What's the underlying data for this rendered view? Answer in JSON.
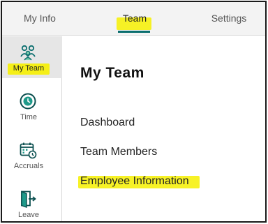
{
  "top_tabs": {
    "my_info": "My Info",
    "team": "Team",
    "settings": "Settings"
  },
  "sidenav": {
    "items": [
      {
        "label": "My Team",
        "icon": "team-icon",
        "selected": true
      },
      {
        "label": "Time",
        "icon": "clock-icon",
        "selected": false
      },
      {
        "label": "Accruals",
        "icon": "calendar-clock-icon",
        "selected": false
      },
      {
        "label": "Leave",
        "icon": "door-exit-icon",
        "selected": false
      }
    ]
  },
  "main": {
    "title": "My Team",
    "links": {
      "dashboard": "Dashboard",
      "team_members": "Team Members",
      "employee_information": "Employee Information"
    }
  },
  "colors": {
    "accent": "#0a6e6e",
    "highlight": "#f6f000",
    "selected_bg": "#e6e6e6"
  }
}
